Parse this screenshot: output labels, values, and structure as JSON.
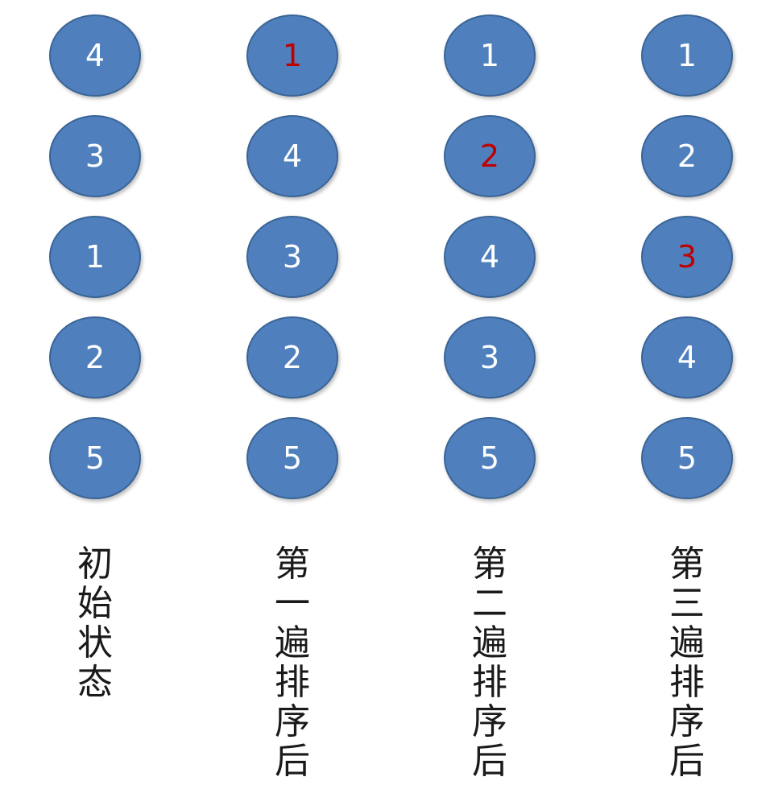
{
  "colors": {
    "node_fill": "#4f80bd",
    "node_border": "#3a6496",
    "node_text": "#ffffff",
    "highlight_text": "#c00000",
    "label_text": "#1a1a1a"
  },
  "columns": [
    {
      "label_chars": [
        "初",
        "始",
        "状",
        "态"
      ],
      "nodes": [
        {
          "value": "4",
          "highlight": false
        },
        {
          "value": "3",
          "highlight": false
        },
        {
          "value": "1",
          "highlight": false
        },
        {
          "value": "2",
          "highlight": false
        },
        {
          "value": "5",
          "highlight": false
        }
      ]
    },
    {
      "label_chars": [
        "第",
        "一",
        "遍",
        "排",
        "序",
        "后"
      ],
      "nodes": [
        {
          "value": "1",
          "highlight": true
        },
        {
          "value": "4",
          "highlight": false
        },
        {
          "value": "3",
          "highlight": false
        },
        {
          "value": "2",
          "highlight": false
        },
        {
          "value": "5",
          "highlight": false
        }
      ]
    },
    {
      "label_chars": [
        "第",
        "二",
        "遍",
        "排",
        "序",
        "后"
      ],
      "nodes": [
        {
          "value": "1",
          "highlight": false
        },
        {
          "value": "2",
          "highlight": true
        },
        {
          "value": "4",
          "highlight": false
        },
        {
          "value": "3",
          "highlight": false
        },
        {
          "value": "5",
          "highlight": false
        }
      ]
    },
    {
      "label_chars": [
        "第",
        "三",
        "遍",
        "排",
        "序",
        "后"
      ],
      "nodes": [
        {
          "value": "1",
          "highlight": false
        },
        {
          "value": "2",
          "highlight": false
        },
        {
          "value": "3",
          "highlight": true
        },
        {
          "value": "4",
          "highlight": false
        },
        {
          "value": "5",
          "highlight": false
        }
      ]
    }
  ]
}
